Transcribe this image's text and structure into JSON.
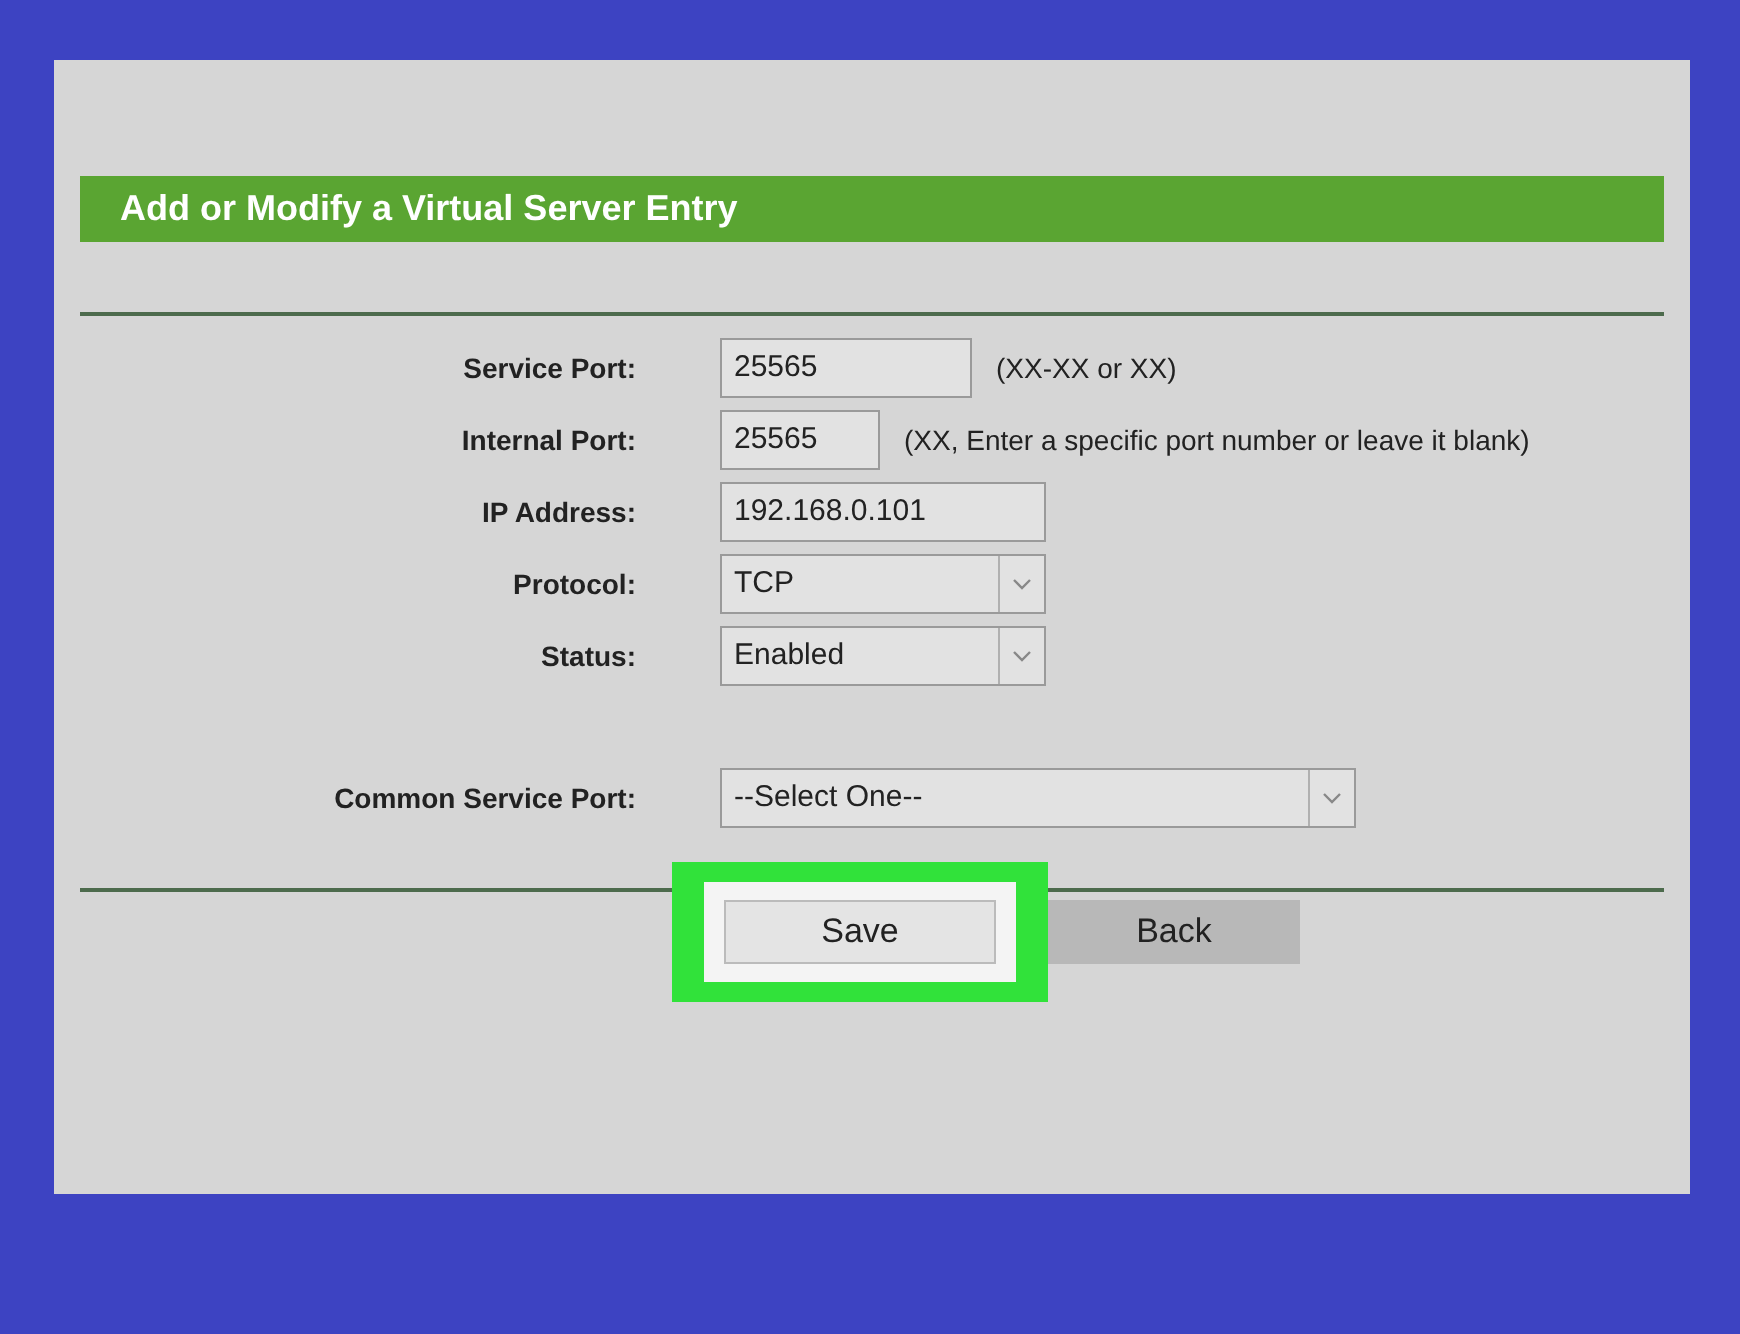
{
  "header": {
    "title": "Add or Modify a Virtual Server Entry"
  },
  "fields": [
    {
      "kind": "text",
      "label": "Service Port:",
      "value": "25565",
      "hint": "(XX-XX or XX)"
    },
    {
      "kind": "text",
      "label": "Internal Port:",
      "value": "25565",
      "hint": "(XX, Enter a specific port number or leave it blank)"
    },
    {
      "kind": "text",
      "label": "IP Address:",
      "value": "192.168.0.101"
    },
    {
      "kind": "select",
      "label": "Protocol:",
      "value": "TCP"
    },
    {
      "kind": "select",
      "label": "Status:",
      "value": "Enabled"
    },
    {
      "kind": "select",
      "label": "Common Service Port:",
      "value": "--Select One--"
    }
  ],
  "buttons": [
    {
      "label": "Save",
      "highlighted": true
    },
    {
      "label": "Back",
      "highlighted": false
    }
  ]
}
